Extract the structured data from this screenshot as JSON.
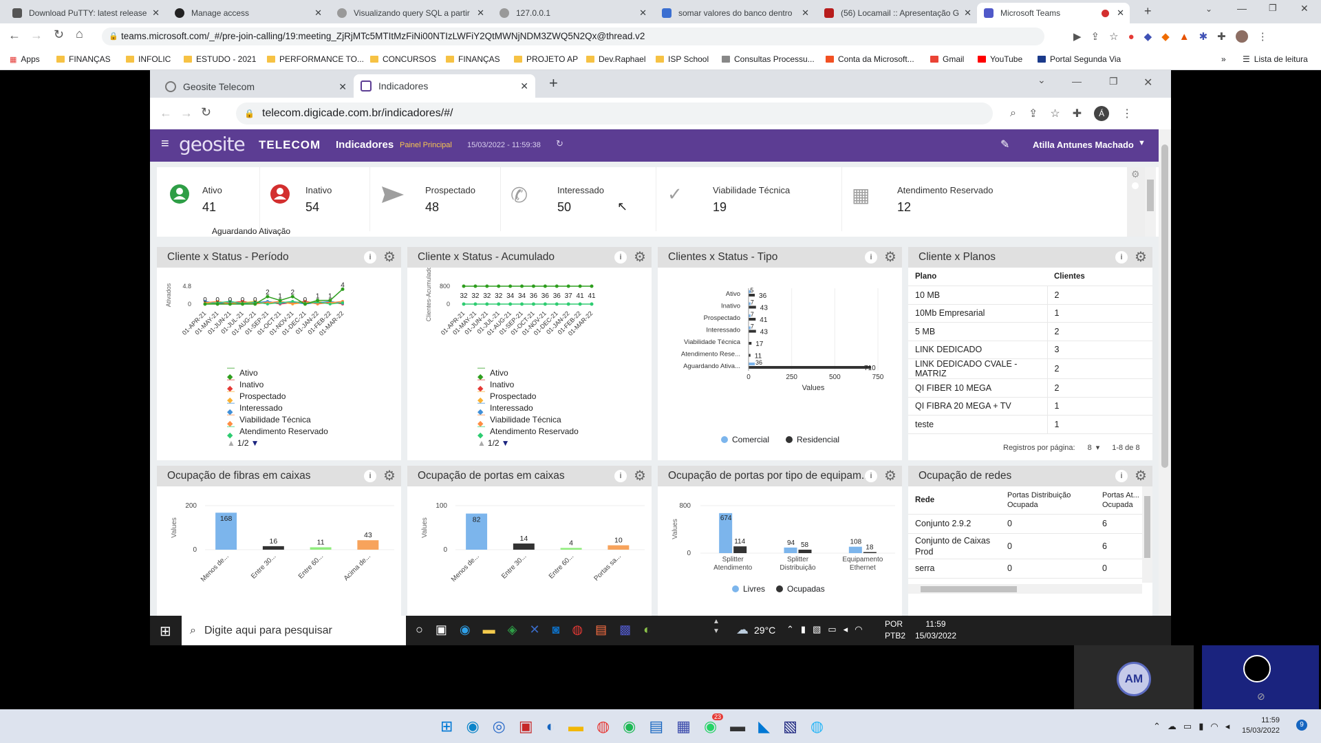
{
  "outer_tabs": [
    {
      "title": "Download PuTTY: latest release",
      "color": "#555"
    },
    {
      "title": "Manage access",
      "color": "#222"
    },
    {
      "title": "Visualizando query SQL a partir",
      "color": "#777"
    },
    {
      "title": "127.0.0.1",
      "color": "#777"
    },
    {
      "title": "somar valores do banco dentro",
      "color": "#3b6fd1"
    },
    {
      "title": "(56) Locamail :: Apresentação G",
      "color": "#b71c1c"
    },
    {
      "title": "Microsoft Teams",
      "color": "#5059c9"
    }
  ],
  "outer_url": "teams.microsoft.com/_#/pre-join-calling/19:meeting_ZjRjMTc5MTItMzFiNi00NTIzLWFiY2QtMWNjNDM3ZWQ5N2Qx@thread.v2",
  "bookmarks": [
    "Apps",
    "FINANÇAS",
    "INFOLIC",
    "ESTUDO - 2021",
    "PERFORMANCE TO...",
    "CONCURSOS",
    "FINANÇAS",
    "PROJETO AP",
    "Dev.Raphael",
    "ISP School",
    "Consultas Processu...",
    "Conta da Microsoft...",
    "Gmail",
    "YouTube",
    "Portal Segunda Via"
  ],
  "reading_list": "Lista de leitura",
  "inner_tabs": [
    "Geosite Telecom",
    "Indicadores"
  ],
  "inner_url": "telecom.digicade.com.br/indicadores/#/",
  "appbar": {
    "logo": "geosite",
    "logo2": "TELECOM",
    "title": "Indicadores",
    "panel": "Painel Principal",
    "datetime": "15/03/2022 - 11:59:38",
    "user": "Atilla Antunes Machado"
  },
  "status_cards": [
    {
      "label": "Ativo",
      "value": "41",
      "color": "#2e9e46"
    },
    {
      "label": "Inativo",
      "value": "54",
      "color": "#d32f2f"
    },
    {
      "label": "Prospectado",
      "value": "48",
      "color": "#9e9e9e"
    },
    {
      "label": "Interessado",
      "value": "50",
      "color": "#9e9e9e"
    },
    {
      "label": "Viabilidade Técnica",
      "value": "19",
      "color": "#9e9e9e"
    },
    {
      "label": "Atendimento Reservado",
      "value": "12",
      "color": "#9e9e9e"
    },
    {
      "label": "Aguardando Ativação",
      "value": "",
      "color": "#9e9e9e"
    }
  ],
  "cards": {
    "c1": "Cliente x Status - Período",
    "c2": "Cliente x Status - Acumulado",
    "c3": "Clientes x Status - Tipo",
    "c4": "Cliente x Planos",
    "c5": "Ocupação de fibras em caixas",
    "c6": "Ocupação de portas em caixas",
    "c7": "Ocupação de portas por tipo de equipam...",
    "c8": "Ocupação de redes"
  },
  "status_legend": [
    "Ativo",
    "Inativo",
    "Prospectado",
    "Interessado",
    "Viabilidade Técnica",
    "Atendimento Reservado"
  ],
  "legend_colors": [
    "#2e9e1e",
    "#e53935",
    "#f9b233",
    "#3f8fd8",
    "#ff8c42",
    "#2ecc71"
  ],
  "legend_pager": "1/2",
  "chart_data": [
    {
      "type": "line",
      "title": "Cliente x Status - Período",
      "ylabel": "Ativados",
      "yticks": [
        0,
        4.8
      ],
      "categories": [
        "01-APR-21",
        "01-MAY-21",
        "01-JUN-21",
        "01-JUL-21",
        "01-AUG-21",
        "01-SEP-21",
        "01-OCT-21",
        "01-NOV-21",
        "01-DEC-21",
        "01-JAN-22",
        "01-FEB-22",
        "01-MAR-22"
      ],
      "series": [
        {
          "name": "Ativo",
          "values": [
            0,
            0,
            0,
            0,
            0,
            2,
            1,
            2,
            0,
            1,
            1,
            4
          ]
        }
      ]
    },
    {
      "type": "line",
      "title": "Cliente x Status - Acumulado",
      "ylabel": "Clientes-Acumulado",
      "yticks": [
        0,
        800
      ],
      "categories": [
        "01-APR-21",
        "01-MAY-21",
        "01-JUN-21",
        "01-JUL-21",
        "01-AUG-21",
        "01-SEP-21",
        "01-OCT-21",
        "01-NOV-21",
        "01-DEC-21",
        "01-JAN-22",
        "01-FEB-22",
        "01-MAR-22"
      ],
      "series": [
        {
          "name": "Ativo",
          "values": [
            32,
            32,
            32,
            32,
            34,
            34,
            36,
            36,
            36,
            37,
            41,
            41
          ]
        }
      ]
    },
    {
      "type": "bar",
      "title": "Clientes x Status - Tipo",
      "xlabel": "Values",
      "xticks": [
        0,
        250,
        500,
        750
      ],
      "orientation": "horizontal",
      "categories": [
        "Ativo",
        "Inativo",
        "Prospectado",
        "Interessado",
        "Viabilidade Técnica",
        "Atendimento Rese...",
        "Aguardando Ativa..."
      ],
      "series": [
        {
          "name": "Comercial",
          "values": [
            5,
            7,
            7,
            7,
            0,
            0,
            36
          ]
        },
        {
          "name": "Residencial",
          "values": [
            36,
            43,
            41,
            43,
            17,
            11,
            710
          ]
        }
      ]
    },
    {
      "type": "bar",
      "title": "Ocupação de fibras em caixas",
      "ylabel": "Values",
      "yticks": [
        0,
        200
      ],
      "categories": [
        "Menos de...",
        "Entre 30...",
        "Entre 60...",
        "Acima de..."
      ],
      "values": [
        168,
        16,
        11,
        43
      ]
    },
    {
      "type": "bar",
      "title": "Ocupação de portas em caixas",
      "ylabel": "Values",
      "yticks": [
        0,
        100
      ],
      "categories": [
        "Menos de...",
        "Entre 30...",
        "Entre 60...",
        "Portas sa..."
      ],
      "values": [
        82,
        14,
        4,
        10
      ]
    },
    {
      "type": "bar",
      "title": "Ocupação de portas por tipo de equipam...",
      "ylabel": "Values",
      "yticks": [
        0,
        800
      ],
      "categories": [
        "Splitter Atendimento",
        "Splitter Distribuição",
        "Equipamento Ethernet"
      ],
      "series": [
        {
          "name": "Livres",
          "values": [
            674,
            94,
            108
          ]
        },
        {
          "name": "Ocupadas",
          "values": [
            114,
            58,
            18
          ]
        }
      ]
    }
  ],
  "tipo_legend": [
    "Comercial",
    "Residencial"
  ],
  "portas_legend": [
    "Livres",
    "Ocupadas"
  ],
  "planos": {
    "headers": [
      "Plano",
      "Clientes"
    ],
    "rows": [
      [
        "10 MB",
        "2"
      ],
      [
        "10Mb Empresarial",
        "1"
      ],
      [
        "5 MB",
        "2"
      ],
      [
        "LINK DEDICADO",
        "3"
      ],
      [
        "LINK DEDICADO CVALE - MATRIZ",
        "2"
      ],
      [
        "QI FIBER 10 MEGA",
        "2"
      ],
      [
        "QI FIBRA 20 MEGA + TV",
        "1"
      ],
      [
        "teste",
        "1"
      ]
    ],
    "footer_label": "Registros por página:",
    "per_page": "8",
    "range": "1-8 de 8"
  },
  "redes": {
    "headers": [
      "Rede",
      "Portas Distribuição Ocupada",
      "Portas At... Ocupada"
    ],
    "rows": [
      [
        "Conjunto 2.9.2",
        "0",
        "6"
      ],
      [
        "Conjunto de Caixas Prod",
        "0",
        "6"
      ],
      [
        "serra",
        "0",
        "0"
      ]
    ]
  },
  "inner_taskbar": {
    "search": "Digite aqui para pesquisar",
    "temp": "29°C",
    "lang": "POR",
    "lang2": "PTB2",
    "time": "11:59",
    "date": "15/03/2022"
  },
  "avatar": "AM",
  "bottom_taskbar": {
    "time": "11:59",
    "date": "15/03/2022",
    "badge": "9",
    "whatsapp_badge": "23"
  }
}
